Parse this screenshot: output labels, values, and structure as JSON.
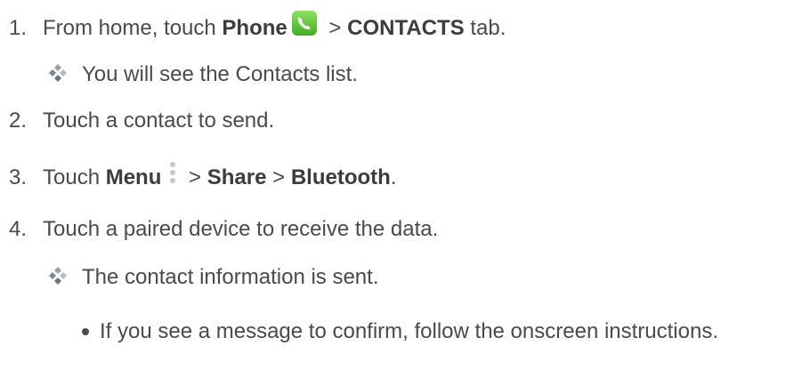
{
  "steps": [
    {
      "num": "1.",
      "t1": "From home, touch ",
      "b1": "Phone",
      "t2": " > ",
      "b2": "CONTACTS",
      "t3": " tab."
    },
    {
      "num": "2.",
      "text": "Touch a contact to send."
    },
    {
      "num": "3.",
      "t1": "Touch ",
      "b1": "Menu",
      "t2": " > ",
      "b2": "Share",
      "t3": " > ",
      "b3": "Bluetooth",
      "t4": "."
    },
    {
      "num": "4.",
      "text": "Touch a paired device to receive the data."
    }
  ],
  "results": [
    "You will see the Contacts list.",
    "The contact information is sent."
  ],
  "note": "If you see a message to confirm, follow the onscreen instructions.",
  "colors": {
    "phone_icon": "#5fcb3a",
    "text": "#4a4a4a"
  },
  "icons": {
    "phone": "phone-icon",
    "menu": "menu-icon",
    "result": "diamond-bullet-icon"
  }
}
